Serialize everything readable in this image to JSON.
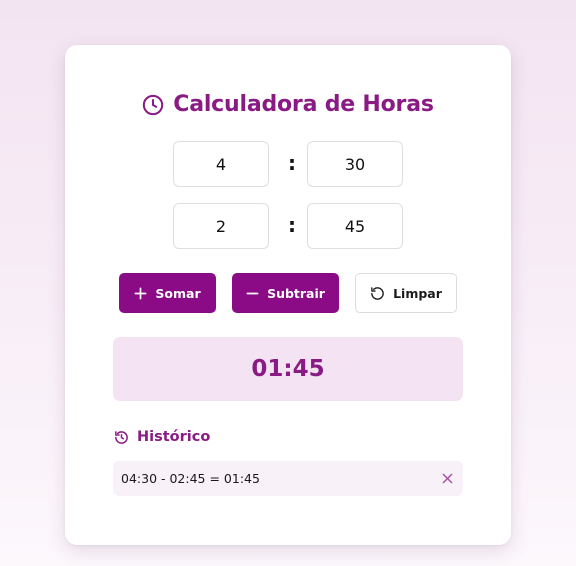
{
  "header": {
    "title": "Calculadora de Horas",
    "icon": "clock-icon"
  },
  "inputs": [
    {
      "hours": "4",
      "minutes": "30",
      "separator": ":"
    },
    {
      "hours": "2",
      "minutes": "45",
      "separator": ":"
    }
  ],
  "buttons": {
    "add_label": "Somar",
    "add_icon": "plus-icon",
    "subtract_label": "Subtrair",
    "subtract_icon": "minus-icon",
    "clear_label": "Limpar",
    "clear_icon": "reset-icon"
  },
  "result": {
    "value": "01:45"
  },
  "history": {
    "title": "Histórico",
    "icon": "history-icon",
    "items": [
      {
        "text": "04:30 - 02:45 = 01:45",
        "remove_icon": "close-icon"
      }
    ]
  },
  "colors": {
    "accent": "#8b0b87",
    "result_bg": "#f4e4f3",
    "history_item_bg": "#f8f1f7"
  }
}
